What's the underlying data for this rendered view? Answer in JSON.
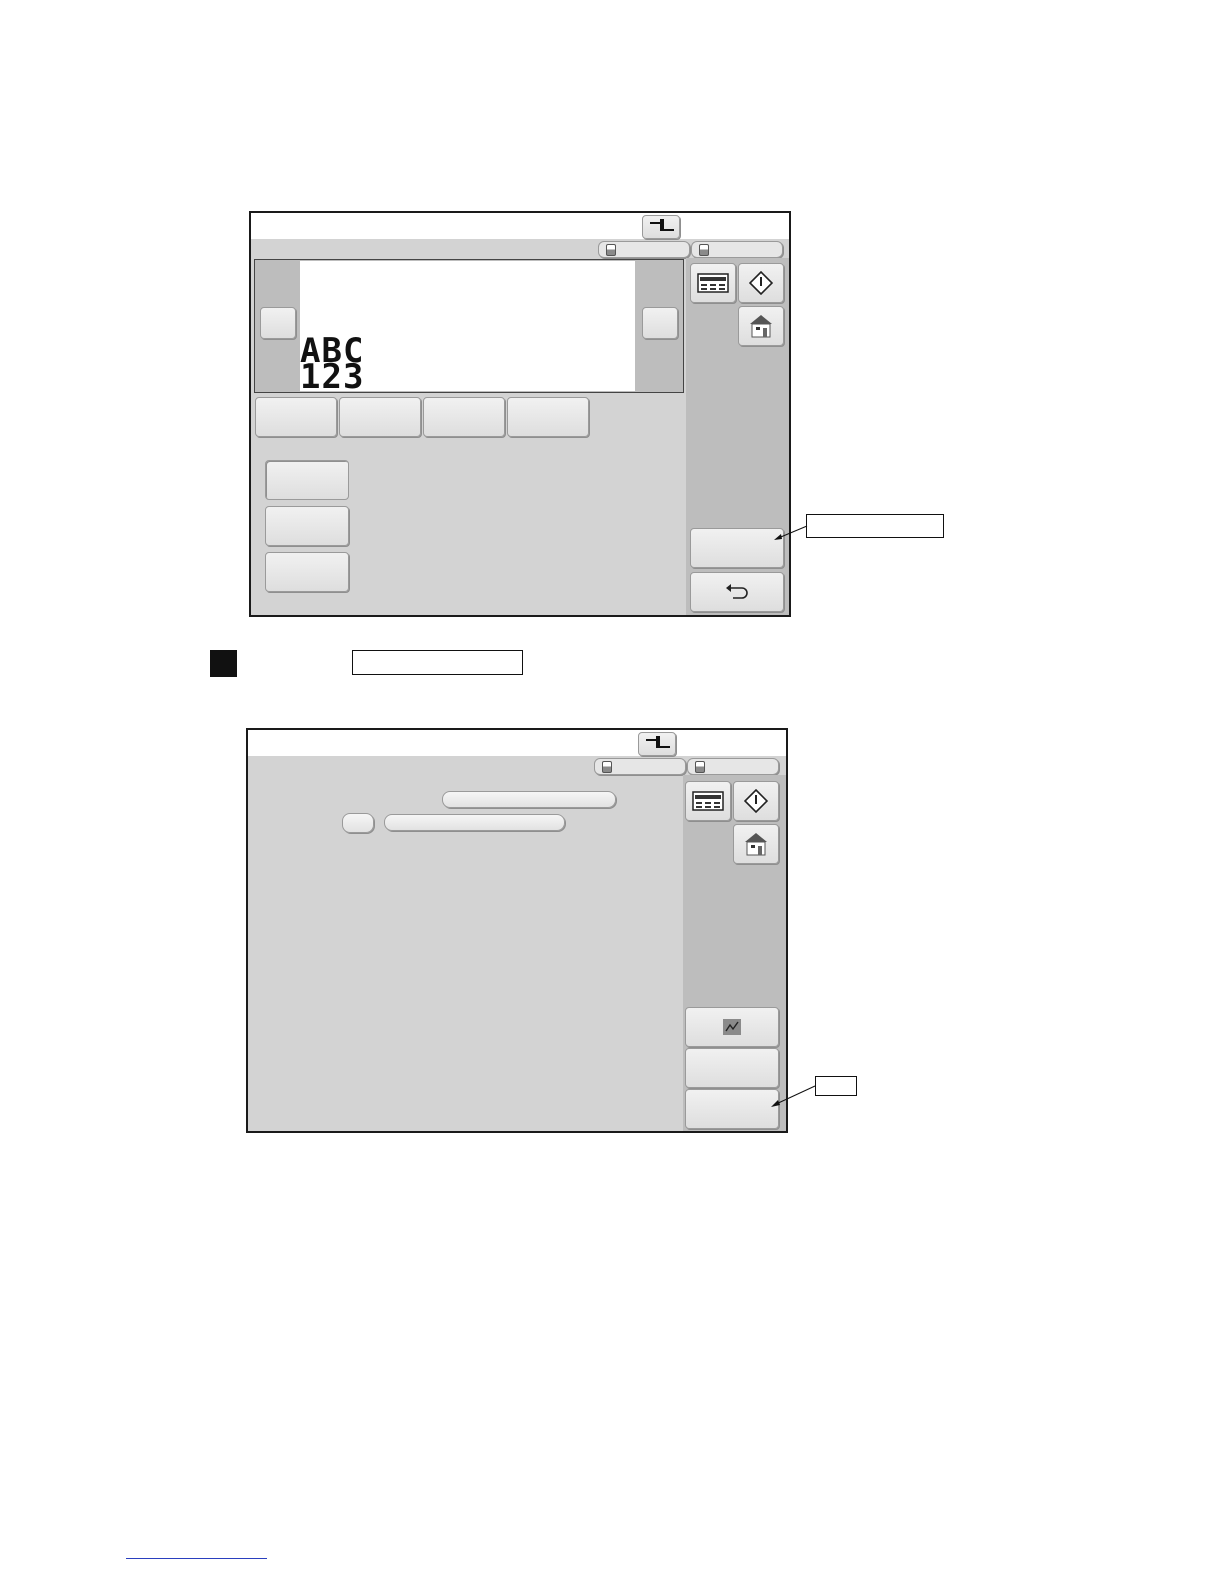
{
  "screen1": {
    "preview_text_line1": "ABC",
    "preview_text_line2": "123",
    "toolbar_icons": [
      "machine-settings-icon",
      "counter-icon",
      "start-icon",
      "home-icon"
    ],
    "back_icon": "return-arrow-icon"
  },
  "screen2": {
    "toolbar_icons": [
      "machine-settings-icon",
      "counter-icon",
      "start-icon",
      "home-icon"
    ],
    "side_icon": "line-graph-icon"
  },
  "colors": {
    "screen_bg": "#d3d3d3",
    "side_panel": "#bdbdbd",
    "button_face": "#e6e6e6",
    "footer_link": "#2a3fbf"
  }
}
